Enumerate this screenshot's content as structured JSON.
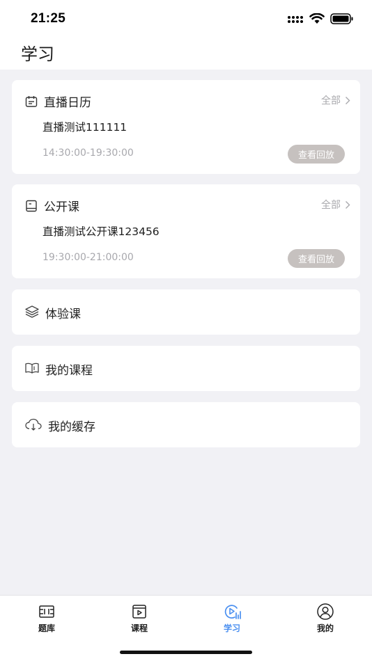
{
  "status_bar": {
    "time": "21:25"
  },
  "header": {
    "title": "学习"
  },
  "live_calendar": {
    "title": "直播日历",
    "see_all": "全部",
    "item_title": "直播测试111111",
    "item_time": "14:30:00-19:30:00",
    "replay_label": "查看回放"
  },
  "open_course": {
    "title": "公开课",
    "see_all": "全部",
    "item_title": "直播测试公开课123456",
    "item_time": "19:30:00-21:00:00",
    "replay_label": "查看回放"
  },
  "rows": {
    "trial": "体验课",
    "my_courses": "我的课程",
    "my_cache": "我的缓存"
  },
  "tabbar": {
    "tabs": [
      {
        "label": "题库",
        "icon": "question-bank-icon",
        "active": false
      },
      {
        "label": "课程",
        "icon": "course-video-icon",
        "active": false
      },
      {
        "label": "学习",
        "icon": "study-play-icon",
        "active": true
      },
      {
        "label": "我的",
        "icon": "profile-icon",
        "active": false
      }
    ],
    "active_color": "#4a8ff0"
  }
}
